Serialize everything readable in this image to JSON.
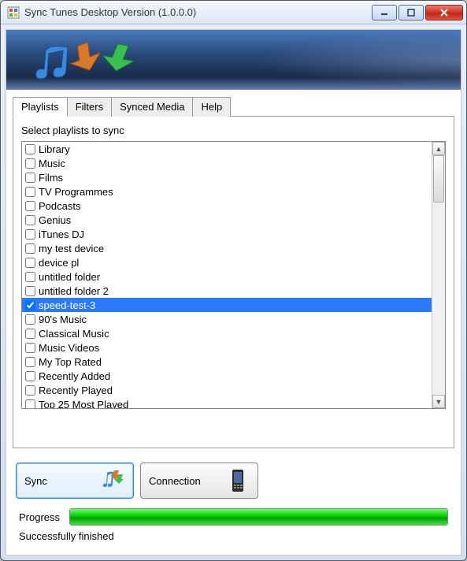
{
  "window": {
    "title": "Sync Tunes Desktop Version (1.0.0.0)"
  },
  "tabs": [
    {
      "label": "Playlists",
      "active": true
    },
    {
      "label": "Filters",
      "active": false
    },
    {
      "label": "Synced Media",
      "active": false
    },
    {
      "label": "Help",
      "active": false
    }
  ],
  "panel": {
    "instruction": "Select playlists to sync"
  },
  "playlists": [
    {
      "name": "Library",
      "checked": false,
      "selected": false
    },
    {
      "name": "Music",
      "checked": false,
      "selected": false
    },
    {
      "name": "Films",
      "checked": false,
      "selected": false
    },
    {
      "name": "TV Programmes",
      "checked": false,
      "selected": false
    },
    {
      "name": "Podcasts",
      "checked": false,
      "selected": false
    },
    {
      "name": "Genius",
      "checked": false,
      "selected": false
    },
    {
      "name": "iTunes DJ",
      "checked": false,
      "selected": false
    },
    {
      "name": "my test device",
      "checked": false,
      "selected": false
    },
    {
      "name": "device pl",
      "checked": false,
      "selected": false
    },
    {
      "name": "untitled folder",
      "checked": false,
      "selected": false
    },
    {
      "name": "untitled folder 2",
      "checked": false,
      "selected": false
    },
    {
      "name": "speed-test-3",
      "checked": true,
      "selected": true
    },
    {
      "name": "90's Music",
      "checked": false,
      "selected": false
    },
    {
      "name": "Classical Music",
      "checked": false,
      "selected": false
    },
    {
      "name": "Music Videos",
      "checked": false,
      "selected": false
    },
    {
      "name": "My Top Rated",
      "checked": false,
      "selected": false
    },
    {
      "name": "Recently Added",
      "checked": false,
      "selected": false
    },
    {
      "name": "Recently Played",
      "checked": false,
      "selected": false
    },
    {
      "name": "Top 25 Most Played",
      "checked": false,
      "selected": false
    }
  ],
  "buttons": {
    "sync": "Sync",
    "connection": "Connection"
  },
  "progress": {
    "label": "Progress",
    "percent": 100,
    "status": "Successfully finished"
  }
}
